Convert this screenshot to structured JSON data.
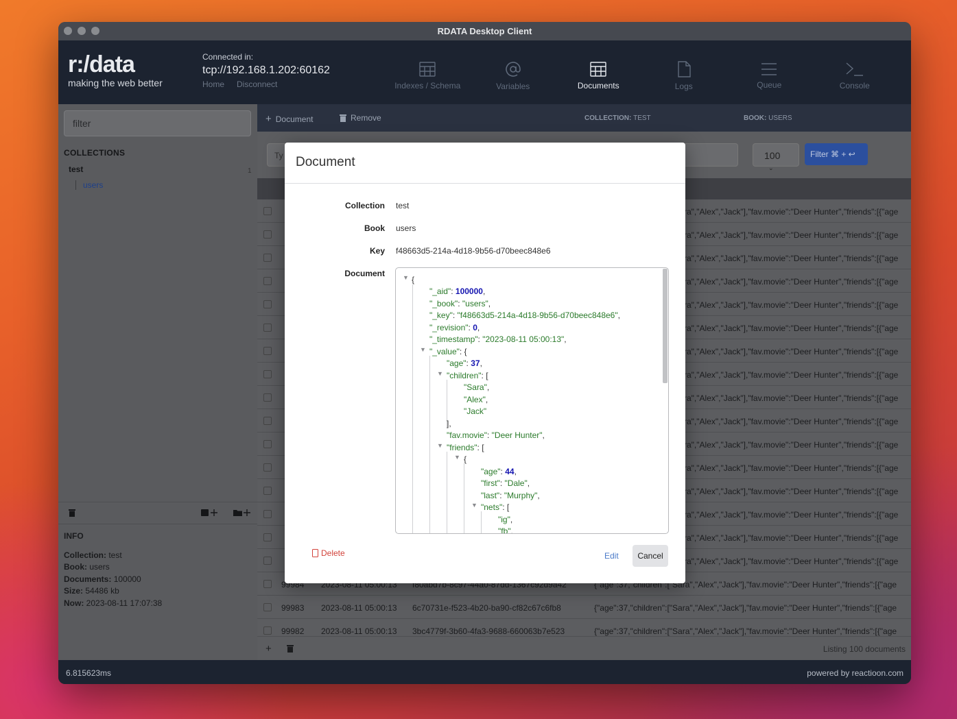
{
  "window": {
    "title": "RDATA Desktop Client"
  },
  "header": {
    "logo": "r:/data",
    "tagline": "making the web better",
    "connected_label": "Connected in:",
    "address": "tcp://192.168.1.202:60162",
    "home_link": "Home",
    "disconnect_link": "Disconnect",
    "nav": [
      {
        "label": "Indexes / Schema",
        "icon": "table-icon"
      },
      {
        "label": "Variables",
        "icon": "at-icon"
      },
      {
        "label": "Documents",
        "icon": "table-icon",
        "active": true
      },
      {
        "label": "Logs",
        "icon": "file-icon"
      },
      {
        "label": "Queue",
        "icon": "list-icon"
      },
      {
        "label": "Console",
        "icon": "terminal-icon"
      }
    ]
  },
  "sidebar": {
    "filter_placeholder": "filter",
    "collections_title": "COLLECTIONS",
    "collection": "test",
    "collection_count": "1",
    "book": "users",
    "info": {
      "title": "INFO",
      "collection_label": "Collection:",
      "collection": "test",
      "book_label": "Book:",
      "book": "users",
      "documents_label": "Documents:",
      "documents": "100000",
      "size_label": "Size:",
      "size": "54486 kb",
      "now_label": "Now:",
      "now": "2023-08-11 17:07:38"
    }
  },
  "toolbar": {
    "add_document": "Document",
    "remove": "Remove",
    "collection_label": "COLLECTION:",
    "collection": "TEST",
    "book_label": "BOOK:",
    "book": "USERS"
  },
  "search": {
    "placeholder": "Ty",
    "limit": "100",
    "filter_label": "Filter ⌘ + ↩"
  },
  "table": {
    "row_value_fragment": "ra\",\"Alex\",\"Jack\"],\"fav.movie\":\"Deer Hunter\",\"friends\":[{\"age",
    "visible_rows": [
      {
        "aid": "99984",
        "timestamp": "2023-08-11 05:00:13",
        "key": "f80abd7b-8c97-44a0-87dd-1367c92d9a42",
        "value": "{\"age\":37,\"children\":[\"Sara\",\"Alex\",\"Jack\"],\"fav.movie\":\"Deer Hunter\",\"friends\":[{\"age"
      },
      {
        "aid": "99983",
        "timestamp": "2023-08-11 05:00:13",
        "key": "6c70731e-f523-4b20-ba90-cf82c67c6fb8",
        "value": "{\"age\":37,\"children\":[\"Sara\",\"Alex\",\"Jack\"],\"fav.movie\":\"Deer Hunter\",\"friends\":[{\"age"
      },
      {
        "aid": "99982",
        "timestamp": "2023-08-11 05:00:13",
        "key": "3bc4779f-3b60-4fa3-9688-660063b7e523",
        "value": "{\"age\":37,\"children\":[\"Sara\",\"Alex\",\"Jack\"],\"fav.movie\":\"Deer Hunter\",\"friends\":[{\"age"
      }
    ],
    "listing": "Listing 100 documents"
  },
  "status": {
    "time": "6.815623ms",
    "powered": "powered by reactioon.com"
  },
  "modal": {
    "title": "Document",
    "collection_label": "Collection",
    "collection": "test",
    "book_label": "Book",
    "book": "users",
    "key_label": "Key",
    "key": "f48663d5-214a-4d18-9b56-d70beec848e6",
    "document_label": "Document",
    "json": {
      "aid": "100000",
      "book": "\"users\"",
      "key": "\"f48663d5-214a-4d18-9b56-d70beec848e6\"",
      "revision": "0",
      "timestamp": "\"2023-08-11 05:00:13\"",
      "age": "37",
      "children": [
        "\"Sara\"",
        "\"Alex\"",
        "\"Jack\""
      ],
      "fav_movie": "\"Deer Hunter\"",
      "friend_age": "44",
      "friend_first": "\"Dale\"",
      "friend_last": "\"Murphy\"",
      "nets": [
        "\"ig\"",
        "\"fb\""
      ]
    },
    "delete": "Delete",
    "edit": "Edit",
    "cancel": "Cancel"
  }
}
